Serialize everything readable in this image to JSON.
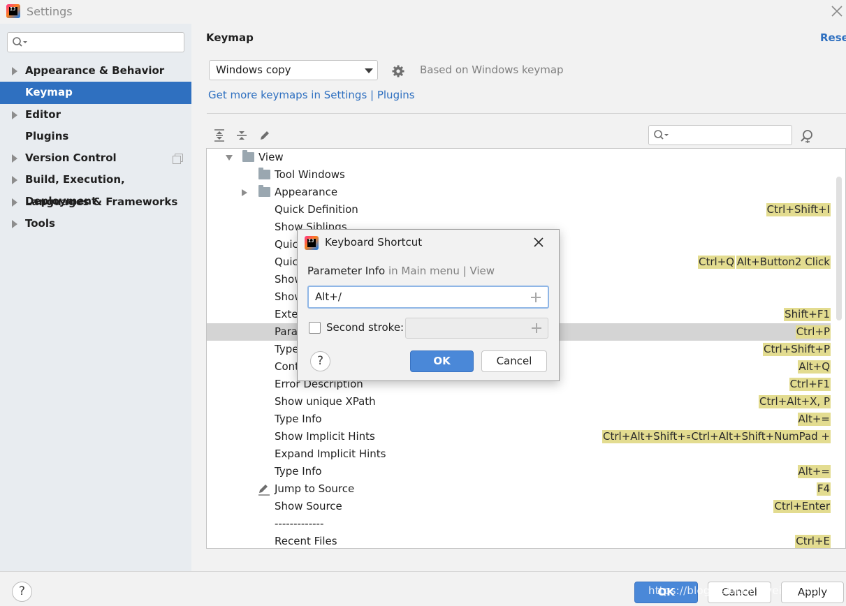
{
  "window": {
    "title": "Settings"
  },
  "sidebar": {
    "search_placeholder": "",
    "items": [
      {
        "label": "Appearance & Behavior",
        "expandable": true,
        "selected": false
      },
      {
        "label": "Keymap",
        "expandable": false,
        "selected": true
      },
      {
        "label": "Editor",
        "expandable": true,
        "selected": false
      },
      {
        "label": "Plugins",
        "expandable": false,
        "selected": false
      },
      {
        "label": "Version Control",
        "expandable": true,
        "selected": false
      },
      {
        "label": "Build, Execution, Deployment",
        "expandable": true,
        "selected": false
      },
      {
        "label": "Languages & Frameworks",
        "expandable": true,
        "selected": false
      },
      {
        "label": "Tools",
        "expandable": true,
        "selected": false
      }
    ]
  },
  "main": {
    "title": "Keymap",
    "reset_label": "Reset",
    "keymap_select": "Windows copy",
    "based_on": "Based on Windows keymap",
    "more_link": "Get more keymaps in Settings | Plugins",
    "tree_search_placeholder": ""
  },
  "tree": {
    "rows": [
      {
        "label": "View",
        "shortcuts": []
      },
      {
        "label": "Tool Windows",
        "shortcuts": []
      },
      {
        "label": "Appearance",
        "shortcuts": []
      },
      {
        "label": "Quick Definition",
        "shortcuts": [
          "Ctrl+Shift+I"
        ]
      },
      {
        "label": "Show Siblings",
        "shortcuts": []
      },
      {
        "label": "Quick Documentation",
        "shortcuts": []
      },
      {
        "label": "Quick Documentation",
        "shortcuts": [
          "Ctrl+Q",
          "Alt+Button2 Click"
        ]
      },
      {
        "label": "Show",
        "shortcuts": []
      },
      {
        "label": "Show",
        "shortcuts": []
      },
      {
        "label": "External Documentation",
        "shortcuts": [
          "Shift+F1"
        ]
      },
      {
        "label": "Parameter Info",
        "shortcuts": [
          "Ctrl+P"
        ]
      },
      {
        "label": "Type",
        "shortcuts": [
          "Ctrl+Shift+P"
        ]
      },
      {
        "label": "Context Info",
        "shortcuts": [
          "Alt+Q"
        ]
      },
      {
        "label": "Error Description",
        "shortcuts": [
          "Ctrl+F1"
        ]
      },
      {
        "label": "Show unique XPath",
        "shortcuts": [
          "Ctrl+Alt+X, P"
        ]
      },
      {
        "label": "Type Info",
        "shortcuts": [
          "Alt+="
        ]
      },
      {
        "label": "Show Implicit Hints",
        "shortcuts": [
          "Ctrl+Alt+Shift+=",
          "Ctrl+Alt+Shift+NumPad +"
        ]
      },
      {
        "label": "Expand Implicit Hints",
        "shortcuts": []
      },
      {
        "label": "Type Info",
        "shortcuts": [
          "Alt+="
        ]
      },
      {
        "label": "Jump to Source",
        "shortcuts": [
          "F4"
        ]
      },
      {
        "label": "Show Source",
        "shortcuts": [
          "Ctrl+Enter"
        ]
      },
      {
        "label": "-------------",
        "shortcuts": []
      },
      {
        "label": "Recent Files",
        "shortcuts": [
          "Ctrl+E"
        ]
      }
    ],
    "visible_labels": {
      "r0": "View",
      "r1": "Tool Windows",
      "r2": "Appearance",
      "r3": "Quick Definition",
      "r4": "Show Siblings",
      "r5": "Quic",
      "r6": "Quic",
      "r7": "Show",
      "r8": "Show",
      "r9": "Exte",
      "r10": "Para",
      "r11": "Type",
      "r12": "Cont",
      "r13": "Error Description",
      "r14": "Show unique XPath",
      "r15": "Type Info",
      "r16": "Show Implicit Hints",
      "r17": "Expand Implicit Hints",
      "r18": "Type Info",
      "r19": "Jump to Source",
      "r20": "Show Source",
      "r21": "-------------",
      "r22": "Recent Files"
    }
  },
  "dialog": {
    "title": "Keyboard Shortcut",
    "action_name": "Parameter Info",
    "action_path": "in Main menu | View",
    "shortcut_value": "Alt+/",
    "second_stroke_label": "Second stroke:",
    "second_stroke_checked": false,
    "ok_label": "OK",
    "cancel_label": "Cancel",
    "help_label": "?"
  },
  "footer": {
    "help_label": "?",
    "ok_label": "OK",
    "cancel_label": "Cancel",
    "apply_label": "Apply",
    "watermark": "https://blog.csdn.net/weixin_45...02"
  },
  "colors": {
    "accent": "#2f70c0",
    "selection": "#2f70c0",
    "shortcut_highlight": "#e3dc90",
    "primary_button": "#4a88d8"
  },
  "icons": {
    "app": "intellij-logo-icon",
    "close": "close-icon",
    "search": "search-icon",
    "gear": "gear-icon",
    "expand_all": "expand-all-icon",
    "collapse_all": "collapse-all-icon",
    "edit": "pencil-icon",
    "find_shortcut": "find-by-shortcut-icon",
    "folder": "folder-icon"
  }
}
